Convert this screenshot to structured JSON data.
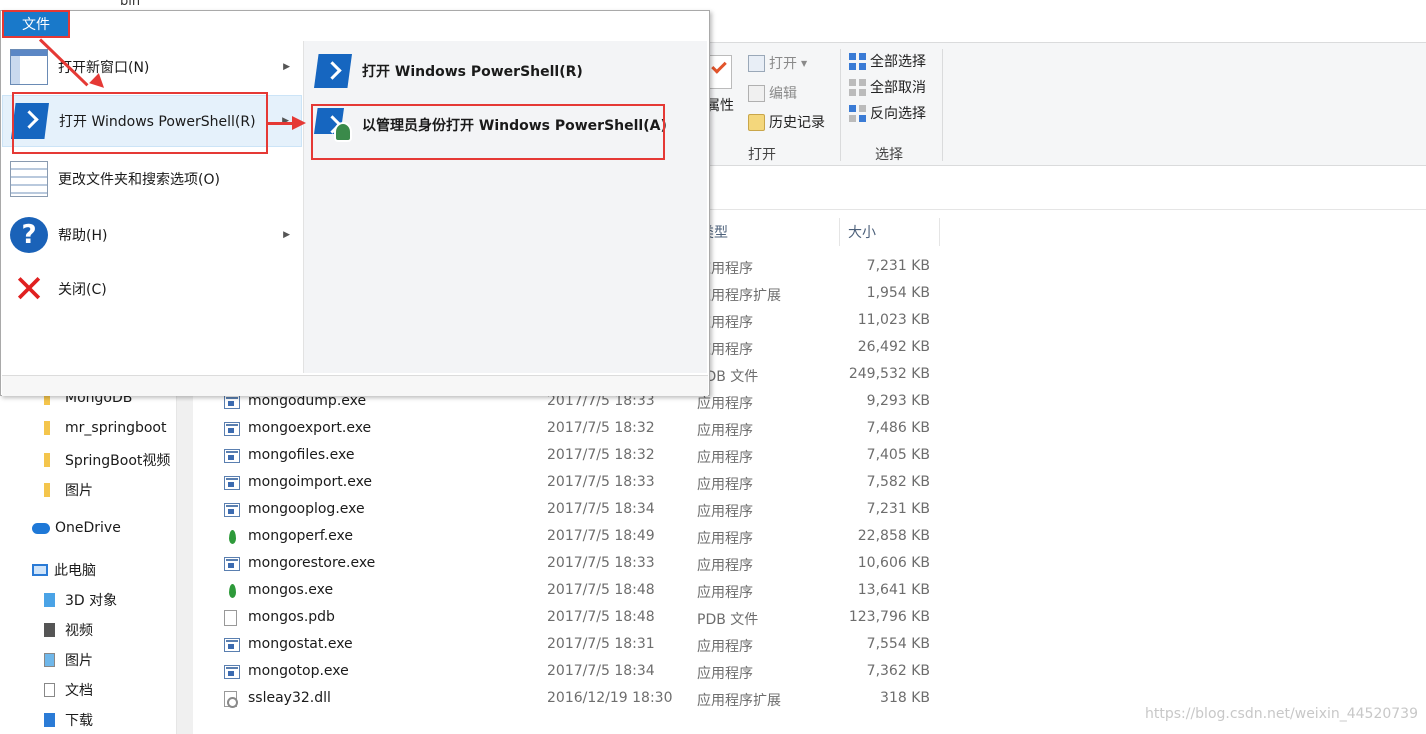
{
  "titlebar": {
    "crumb": "bin"
  },
  "file_menu": {
    "tab_label": "文件",
    "left_items": [
      {
        "label": "打开新窗口(N)",
        "has_submenu": true
      },
      {
        "label": "打开 Windows PowerShell(R)",
        "has_submenu": true
      },
      {
        "label": "更改文件夹和搜索选项(O)",
        "has_submenu": false
      },
      {
        "label": "帮助(H)",
        "has_submenu": true
      },
      {
        "label": "关闭(C)",
        "has_submenu": false
      }
    ],
    "submenu_items": [
      {
        "label": "打开 Windows PowerShell(R)"
      },
      {
        "label": "以管理员身份打开 Windows PowerShell(A)"
      }
    ]
  },
  "ribbon": {
    "properties_label": "属性",
    "open_label": "打开",
    "edit_label": "编辑",
    "history_label": "历史记录",
    "open_group": "打开",
    "select_all": "全部选择",
    "select_none": "全部取消",
    "invert_selection": "反向选择",
    "select_group": "选择"
  },
  "columns": {
    "type": "类型",
    "size": "大小"
  },
  "partial_rows": [
    {
      "type": "应用程序",
      "size": "7,231 KB"
    },
    {
      "type": "应用程序扩展",
      "size": "1,954 KB"
    },
    {
      "type": "应用程序",
      "size": "11,023 KB"
    },
    {
      "type": "应用程序",
      "size": "26,492 KB"
    },
    {
      "type": "PDB 文件",
      "size": "249,532 KB"
    }
  ],
  "files": [
    {
      "name": "mongodump.exe",
      "date": "2017/7/5 18:33",
      "type": "应用程序",
      "size": "9,293 KB",
      "icon": "exe-icon"
    },
    {
      "name": "mongoexport.exe",
      "date": "2017/7/5 18:32",
      "type": "应用程序",
      "size": "7,486 KB",
      "icon": "exe-icon"
    },
    {
      "name": "mongofiles.exe",
      "date": "2017/7/5 18:32",
      "type": "应用程序",
      "size": "7,405 KB",
      "icon": "exe-icon"
    },
    {
      "name": "mongoimport.exe",
      "date": "2017/7/5 18:33",
      "type": "应用程序",
      "size": "7,582 KB",
      "icon": "exe-icon"
    },
    {
      "name": "mongooplog.exe",
      "date": "2017/7/5 18:34",
      "type": "应用程序",
      "size": "7,231 KB",
      "icon": "exe-icon"
    },
    {
      "name": "mongoperf.exe",
      "date": "2017/7/5 18:49",
      "type": "应用程序",
      "size": "22,858 KB",
      "icon": "mongo-leaf-icon"
    },
    {
      "name": "mongorestore.exe",
      "date": "2017/7/5 18:33",
      "type": "应用程序",
      "size": "10,606 KB",
      "icon": "exe-icon"
    },
    {
      "name": "mongos.exe",
      "date": "2017/7/5 18:48",
      "type": "应用程序",
      "size": "13,641 KB",
      "icon": "mongo-leaf-icon"
    },
    {
      "name": "mongos.pdb",
      "date": "2017/7/5 18:48",
      "type": "PDB 文件",
      "size": "123,796 KB",
      "icon": "document-icon"
    },
    {
      "name": "mongostat.exe",
      "date": "2017/7/5 18:31",
      "type": "应用程序",
      "size": "7,554 KB",
      "icon": "exe-icon"
    },
    {
      "name": "mongotop.exe",
      "date": "2017/7/5 18:34",
      "type": "应用程序",
      "size": "7,362 KB",
      "icon": "exe-icon"
    },
    {
      "name": "ssleay32.dll",
      "date": "2016/12/19 18:30",
      "type": "应用程序扩展",
      "size": "318 KB",
      "icon": "dll-icon"
    }
  ],
  "nav": {
    "items": [
      {
        "label": "MongoDB"
      },
      {
        "label": "mr_springboot"
      },
      {
        "label": "SpringBoot视频"
      },
      {
        "label": "图片"
      },
      {
        "label": "OneDrive"
      },
      {
        "label": "此电脑"
      },
      {
        "label": "3D 对象"
      },
      {
        "label": "视频"
      },
      {
        "label": "图片"
      },
      {
        "label": "文档"
      },
      {
        "label": "下载"
      }
    ]
  },
  "watermark": "https://blog.csdn.net/weixin_44520739",
  "colors": {
    "accent": "#1979ca",
    "annotation": "#e53935",
    "folder": "#f4c54c"
  }
}
